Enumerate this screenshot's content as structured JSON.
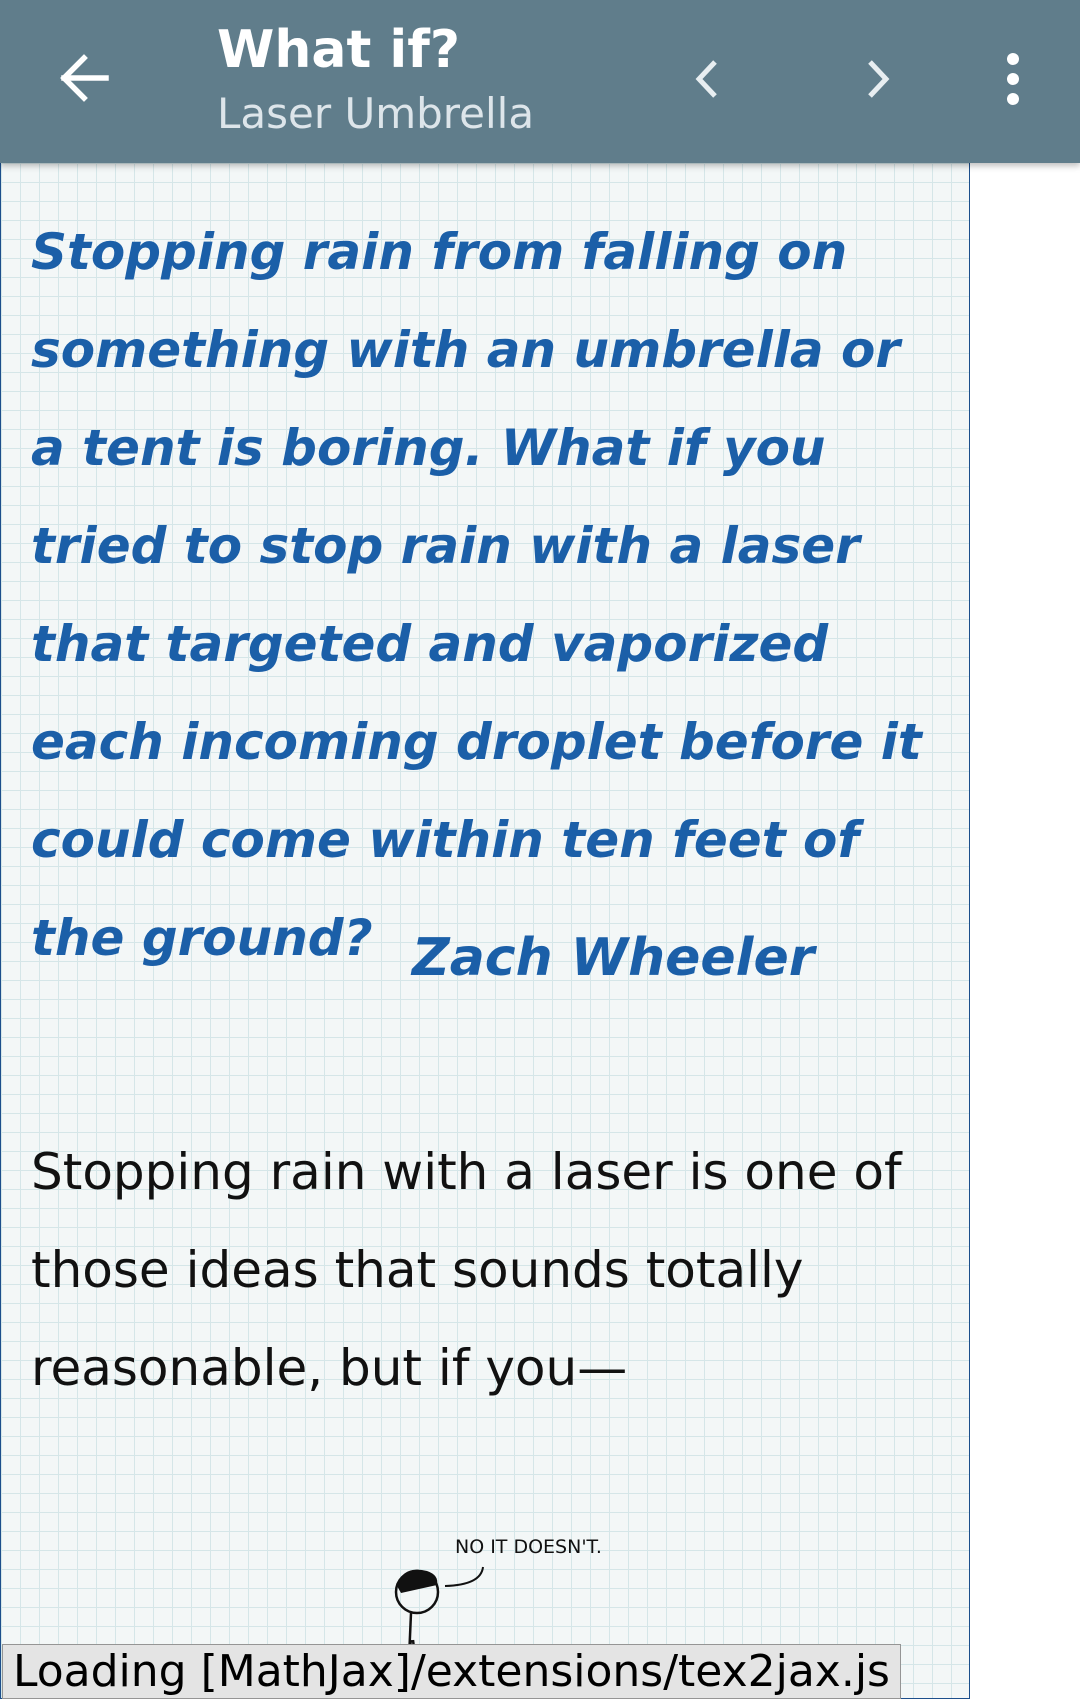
{
  "app_bar": {
    "title": "What if?",
    "subtitle": "Laser Umbrella",
    "back_icon": "arrow-left-icon",
    "prev_icon": "chevron-left-icon",
    "next_icon": "chevron-right-icon",
    "more_icon": "more-vertical-icon",
    "background_color": "#607d8b"
  },
  "article": {
    "question": "Stopping rain from falling on something with an umbrella or a tent is boring. What if you tried to stop rain with a laser that targeted and vaporized each incoming droplet before it could come within ten feet of the ground?",
    "attribution": "Zach Wheeler",
    "paragraph": "Stopping rain with a laser is one of those ideas that sounds totally reasonable, but if you—",
    "comic_caption": "NO IT DOESN'T.",
    "question_color": "#1b5fa8"
  },
  "status": {
    "mathjax_message": "Loading [MathJax]/extensions/tex2jax.js"
  }
}
